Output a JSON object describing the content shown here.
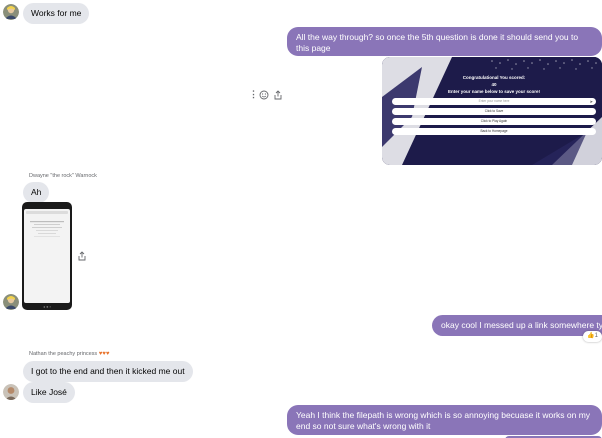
{
  "messages": {
    "m1": {
      "text": "Works for me"
    },
    "m2": {
      "text": "All the way through? so once the 5th question is done it should send you to this page"
    },
    "m3": {
      "card_title": "Congratulational You scored:",
      "card_score": "40",
      "card_subtitle": "Enter your name below to save your score!",
      "card_placeholder": "Enter your name here",
      "card_btn_share": "Click to Save",
      "card_btn_play": "Click to Play Again",
      "card_btn_home": "Back to Homepage"
    },
    "m4": {
      "sender": "Dwayne \"the rock\" Warnock",
      "text": "Ah"
    },
    "m6": {
      "text": "okay cool I messed up a link somewhere tyty",
      "reaction_count": "1"
    },
    "m7": {
      "sender": "Nathan the peachy princess",
      "text": "I got to the end and then it kicked me out"
    },
    "m8": {
      "text": "Like José"
    },
    "m9": {
      "text": "Yeah I think the filepath is wrong which is so annoying becuase it works on my end so not sure what's wrong with it"
    }
  },
  "icons": {
    "more": "more-vertical-icon",
    "react": "smiley-icon",
    "share": "share-icon",
    "heart": "heart-icon",
    "thumbs": "thumbs-up-icon"
  },
  "colors": {
    "outgoing_bubble": "#8a75b8",
    "incoming_bubble": "#e4e6eb",
    "card_bg": "#1d1b4a"
  }
}
